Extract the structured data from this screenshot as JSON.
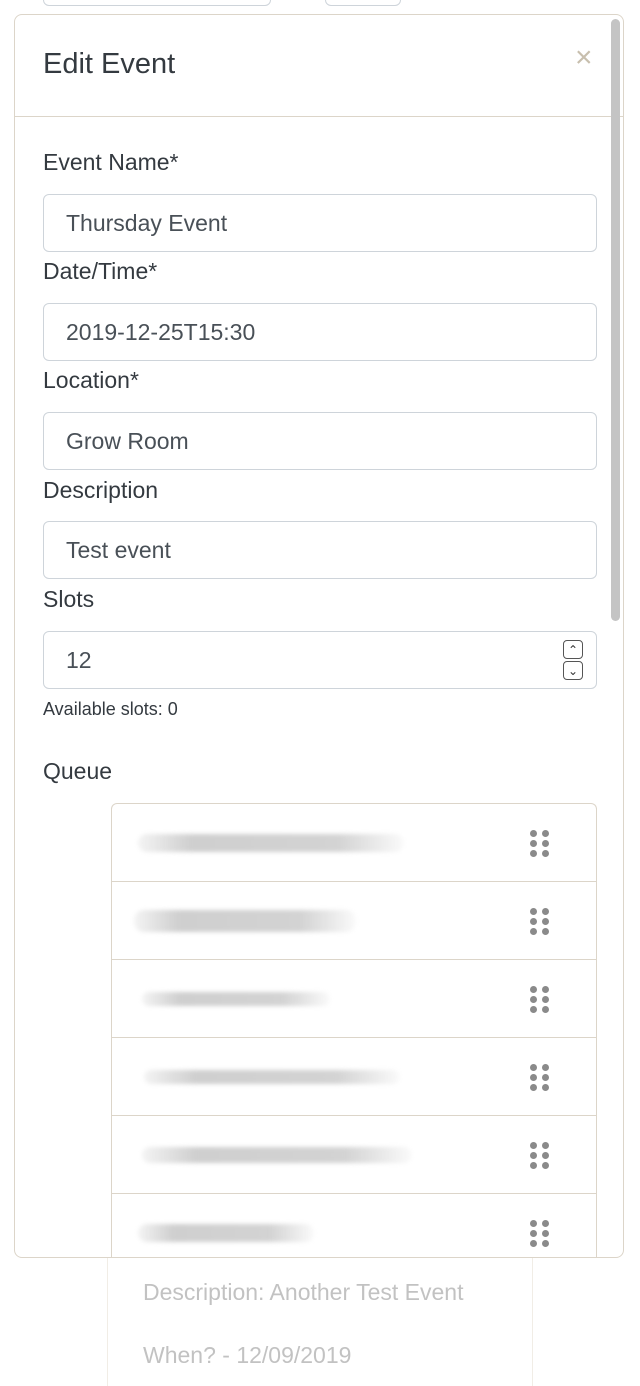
{
  "modal": {
    "title": "Edit Event",
    "close_label": "×"
  },
  "form": {
    "event_name": {
      "label": "Event Name*",
      "value": "Thursday Event"
    },
    "date_time": {
      "label": "Date/Time*",
      "value": "2019-12-25T15:30"
    },
    "location": {
      "label": "Location*",
      "value": "Grow Room"
    },
    "description": {
      "label": "Description",
      "value": "Test event"
    },
    "slots": {
      "label": "Slots",
      "value": "12",
      "help": "Available slots: 0"
    }
  },
  "queue": {
    "label": "Queue",
    "items": [
      "",
      "",
      "",
      "",
      "",
      ""
    ]
  },
  "background": {
    "description": "Description: Another Test Event",
    "when": "When? - 12/09/2019"
  },
  "icons": {
    "close": "close-icon",
    "drag": "drag-handle-icon",
    "spinner_up": "chevron-up-icon",
    "spinner_down": "chevron-down-icon"
  }
}
